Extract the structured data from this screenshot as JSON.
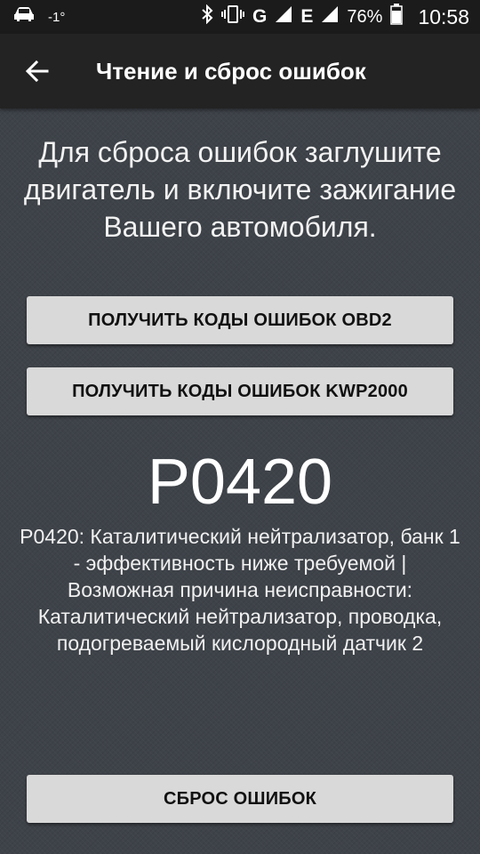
{
  "status_bar": {
    "temperature": "-1°",
    "network": "G",
    "network2": "E",
    "battery_percent": "76%",
    "time": "10:58"
  },
  "toolbar": {
    "title": "Чтение и сброс ошибок"
  },
  "main": {
    "instruction": "Для сброса ошибок заглушите двигатель и включите зажигание Вашего автомобиля.",
    "obd2_button_label": "ПОЛУЧИТЬ КОДЫ ОШИБОК OBD2",
    "kwp2000_button_label": "ПОЛУЧИТЬ КОДЫ ОШИБОК KWP2000",
    "error_code": "P0420",
    "error_description": "P0420: Каталитический нейтрализатор, банк 1 - эффективность ниже требуемой | Возможная причина неисправности: Каталитический нейтрализатор, проводка, подогреваемый кислородный датчик 2",
    "reset_button_label": "СБРОС ОШИБОК"
  }
}
